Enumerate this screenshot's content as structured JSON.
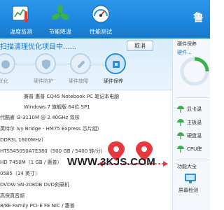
{
  "toolbar": {
    "items": [
      {
        "label": "温度监测",
        "icon": "thermometer-chart-icon"
      },
      {
        "label": "节能降温",
        "icon": "fan-icon"
      },
      {
        "label": "性能测试",
        "icon": "speedometer-icon"
      }
    ],
    "logo_text": "鲁",
    "accent_color": "#1c86de"
  },
  "scan": {
    "title": "扫描清理优化项目中......",
    "button_label": "取消",
    "steps": [
      {
        "label": "优化",
        "icon": "optimize-icon"
      },
      {
        "label": "硬件防护",
        "icon": "shield-icon"
      },
      {
        "label": "硬件故障",
        "icon": "wrench-icon"
      },
      {
        "label": "硬件保养",
        "icon": "cpu-care-icon"
      }
    ]
  },
  "info_rows": [
    {
      "key": "",
      "value": "賽普 惠普 CQ45 Notebook PC 笔记本电脑"
    },
    {
      "key": "",
      "value": "Windows 7 旗舰版 64位 SP1"
    },
    {
      "key": "",
      "value": "代酷睿 i3-3110M @ 2.40GHz 双核"
    },
    {
      "key": "",
      "value": "英特尔 Ivy Bridge - HM75 Express 芯片组）"
    },
    {
      "key": "",
      "value": "DDR3L 1600MHz）"
    },
    {
      "key": "",
      "value": "HTS545050A7E380（500 GB / 5400 转/分）"
    },
    {
      "key": "",
      "value": "HD 7450M（1 GB / 惠普）"
    },
    {
      "key": "",
      "value": "0585（14 英寸）"
    },
    {
      "key": "",
      "value": "DVDW SN-208DB DVD刻录机"
    },
    {
      "key": "",
      "value": "高保真音频"
    },
    {
      "key": "",
      "value": "8/8E Family PCI-E FE NIC / 惠普"
    }
  ],
  "right_panel": {
    "title": "硬件保养",
    "sub_label": "硬件...",
    "items": [
      {
        "label": "显卡温",
        "icon": "umbrella-icon"
      },
      {
        "label": "主板温",
        "icon": "umbrella-icon"
      },
      {
        "label": "硬盘温",
        "icon": "umbrella-icon"
      },
      {
        "label": "CPU使",
        "icon": "umbrella-icon"
      }
    ],
    "functions_title": "功能大全",
    "function_item": "屏幕检测"
  },
  "watermark": {
    "text": "WWW.3KJS.COM"
  }
}
